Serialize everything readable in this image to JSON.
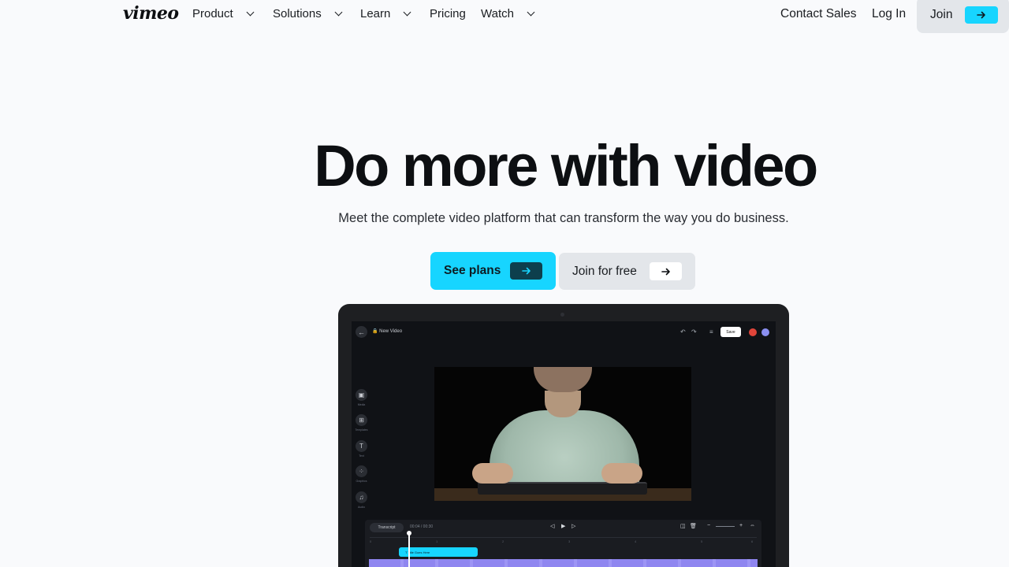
{
  "nav": {
    "logo": "vimeo",
    "items": [
      {
        "label": "Product",
        "has_dropdown": true
      },
      {
        "label": "Solutions",
        "has_dropdown": true
      },
      {
        "label": "Learn",
        "has_dropdown": true
      },
      {
        "label": "Pricing",
        "has_dropdown": false
      },
      {
        "label": "Watch",
        "has_dropdown": true
      }
    ],
    "contact_sales": "Contact Sales",
    "log_in": "Log In",
    "join": "Join",
    "join_icon": "arrow-right-icon"
  },
  "hero": {
    "title": "Do more with video",
    "subtitle": "Meet the complete video platform that can transform the way you do business.",
    "primary_cta": "See plans",
    "secondary_cta": "Join for free"
  },
  "editor": {
    "project_title": "🔒 New Video",
    "save_label": "Save",
    "tools": [
      {
        "label": "Media",
        "icon": "image-icon"
      },
      {
        "label": "Templates",
        "icon": "layout-icon"
      },
      {
        "label": "Text",
        "icon": "text-icon"
      },
      {
        "label": "Graphics",
        "icon": "graphics-icon"
      },
      {
        "label": "Audio",
        "icon": "music-icon"
      }
    ],
    "timeline": {
      "transcript_label": "Transcript",
      "time": "00:04 / 00:30",
      "clip_label": "T  Title Goes Here",
      "ticks": [
        "0",
        "1",
        "2",
        "3",
        "4",
        "5",
        "6"
      ]
    }
  },
  "colors": {
    "accent": "#17d5ff",
    "background": "#f9fafc",
    "secondary_button": "#e3e6ea",
    "text": "#0d0f12"
  }
}
